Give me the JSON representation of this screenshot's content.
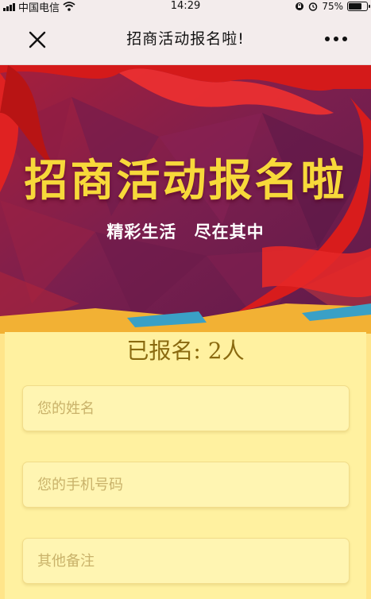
{
  "status_bar": {
    "carrier": "中国电信",
    "time": "14:29",
    "battery": "75%",
    "battery_level": 0.75
  },
  "nav": {
    "title": "招商活动报名啦!"
  },
  "banner": {
    "title": "招商活动报名啦",
    "subtitle": "精彩生活 尽在其中"
  },
  "form": {
    "count": "已报名: 2人",
    "name_placeholder": "您的姓名",
    "phone_placeholder": "您的手机号码",
    "notes_placeholder": "其他备注"
  },
  "colors": {
    "banner_purple": "#7a1f4e",
    "banner_red": "#b71c2c",
    "title_yellow": "#f7d93a",
    "panel_yellow": "#fff1a0"
  },
  "icons": [
    "signal-icon",
    "wifi-icon",
    "lock-rotation-icon",
    "alarm-icon",
    "battery-icon",
    "close-icon",
    "more-icon"
  ]
}
